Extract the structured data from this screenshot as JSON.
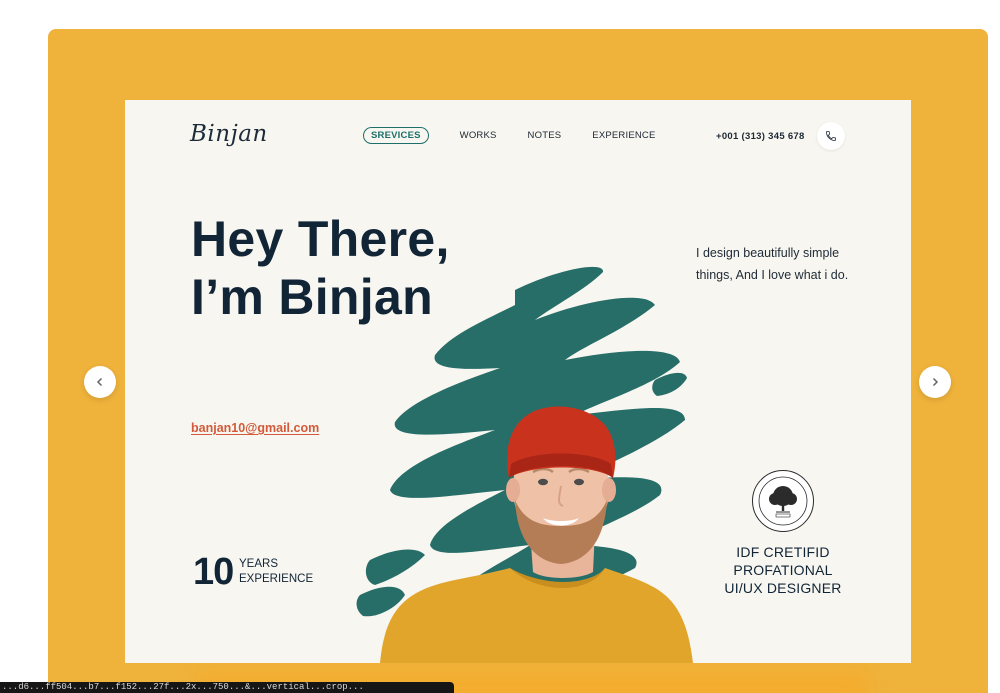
{
  "site": {
    "logo": "Binjan",
    "nav": [
      {
        "label": "SREVICES",
        "active": true
      },
      {
        "label": "WORKS",
        "active": false
      },
      {
        "label": "NOTES",
        "active": false
      },
      {
        "label": "EXPERIENCE",
        "active": false
      }
    ],
    "phone": "+001 (313) 345 678",
    "phone_icon": "phone-icon"
  },
  "hero": {
    "headline_line1": "Hey There,",
    "headline_line2": "I’m Binjan",
    "tagline": "I design beautifully simple things, And I love what i do.",
    "email": "banjan10@gmail.com",
    "years_number": "10",
    "years_label_line1": "YEARS",
    "years_label_line2": "EXPERIENCE",
    "cert_line1": "IDF CRETIFID",
    "cert_line2": "PROFATIONAL",
    "cert_line3": "UI/UX DESIGNER",
    "badge_icon": "tree-seal-icon"
  },
  "carousel": {
    "prev_icon": "chevron-left-icon",
    "next_icon": "chevron-right-icon"
  },
  "status_url": "...d6...ff504...b7...f152...27f...2x...750...&...vertical...crop...",
  "colors": {
    "frame_bg": "#efb23b",
    "slide_bg": "#f8f6f0",
    "brush_teal": "#276e69",
    "accent_green": "#1e6f6a",
    "email_red": "#d25a3a",
    "heading_navy": "#112537",
    "beanie_red": "#c9321d",
    "sweater_yellow": "#e2a52c"
  }
}
